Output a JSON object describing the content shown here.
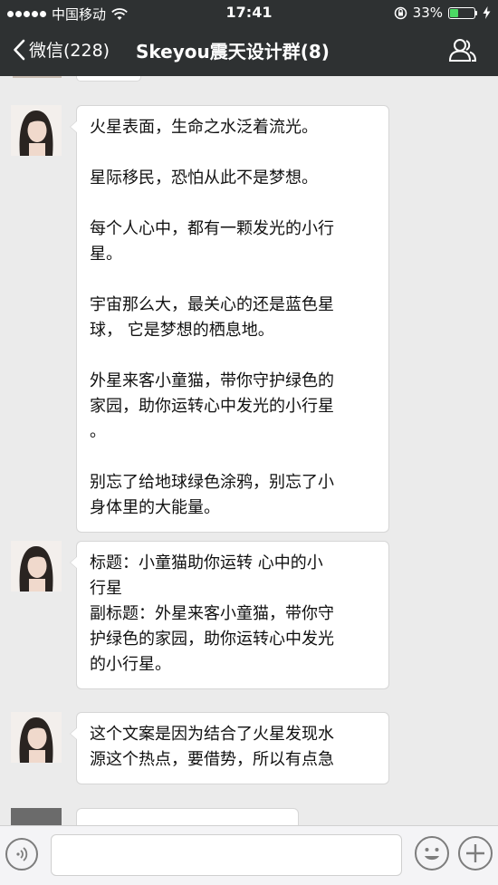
{
  "status_bar": {
    "carrier": "中国移动",
    "time": "17:41",
    "battery": "33%",
    "battery_level": 0.33
  },
  "nav": {
    "back_label": "微信(228)",
    "title": "Skeyou震天设计群(8)"
  },
  "messages": [
    {
      "paragraphs": [
        [
          "火星表面，生命之水泛着流光。"
        ],
        [
          "星际移民，恐怕从此不是梦想。"
        ],
        [
          "每个人心中，都有一颗发光的小行",
          "星。"
        ],
        [
          "宇宙那么大，最关心的还是蓝色星",
          "球， 它是梦想的栖息地。"
        ],
        [
          "外星来客小童猫，带你守护绿色的",
          "家园，助你运转心中发光的小行星",
          "。"
        ],
        [
          "别忘了给地球绿色涂鸦，别忘了小",
          "身体里的大能量。"
        ]
      ]
    },
    {
      "paragraphs": [
        [
          "标题：小童猫助你运转 心中的小",
          "行星",
          "副标题：外星来客小童猫，带你守",
          "护绿色的家园，助你运转心中发光",
          "的小行星。"
        ]
      ]
    },
    {
      "paragraphs": [
        [
          "这个文案是因为结合了火星发现水",
          "源这个热点，要借势，所以有点急"
        ]
      ]
    }
  ],
  "input": {
    "value": ""
  }
}
